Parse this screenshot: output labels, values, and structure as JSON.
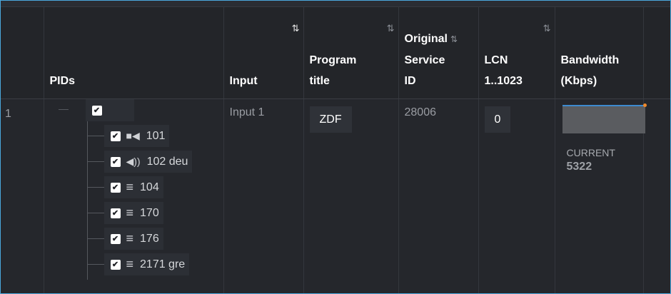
{
  "columns": {
    "pids": "PIDs",
    "input": "Input",
    "program_title": [
      "Program",
      "title"
    ],
    "original_service_id": [
      "Original",
      "Service",
      "ID"
    ],
    "lcn": [
      "LCN",
      "1..1023"
    ],
    "bandwidth": [
      "Bandwidth",
      "(Kbps)"
    ],
    "sort_icon": "⇅"
  },
  "row": {
    "index": "1",
    "input": "Input 1",
    "program_title": "ZDF",
    "original_service_id": "28006",
    "lcn": "0",
    "bandwidth_caption": "CURRENT",
    "bandwidth_value": "5322",
    "pids": [
      {
        "label": "101",
        "icon": "video-camera-icon",
        "glyph": "■◀"
      },
      {
        "label": "102 deu",
        "icon": "speaker-icon",
        "glyph": "◀))"
      },
      {
        "label": "104",
        "icon": "data-lines-icon",
        "glyph": "≡"
      },
      {
        "label": "170",
        "icon": "data-lines-icon",
        "glyph": "≡"
      },
      {
        "label": "176",
        "icon": "data-lines-icon",
        "glyph": "≡"
      },
      {
        "label": "2171 gre",
        "icon": "data-lines-icon",
        "glyph": "≡"
      }
    ]
  },
  "colors": {
    "background": "#232529",
    "frame_border": "#4aa8dc",
    "bandwidth_line": "#3d8bd0",
    "bandwidth_marker": "#f08a2c"
  }
}
